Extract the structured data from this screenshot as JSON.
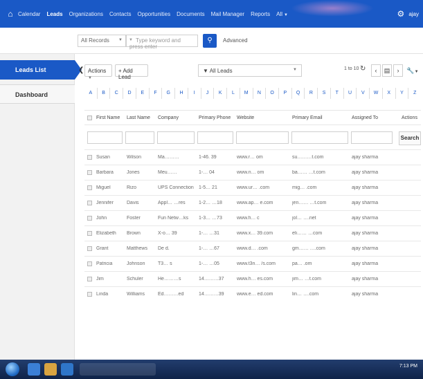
{
  "nav": {
    "items": [
      {
        "label": "Calendar",
        "active": false
      },
      {
        "label": "Leads",
        "active": true
      },
      {
        "label": "Organizations",
        "active": false
      },
      {
        "label": "Contacts",
        "active": false
      },
      {
        "label": "Opportunities",
        "active": false
      },
      {
        "label": "Documents",
        "active": false
      },
      {
        "label": "Mail Manager",
        "active": false
      },
      {
        "label": "Reports",
        "active": false
      },
      {
        "label": "All",
        "active": false
      }
    ],
    "user": "ajay",
    "home_icon": "home-icon",
    "settings_icon": "gear-icon"
  },
  "search": {
    "scope": "All Records",
    "placeholder": "Type keyword and press enter",
    "advanced": "Advanced"
  },
  "sidebar": {
    "items": [
      {
        "label": "Leads List"
      },
      {
        "label": "Dashboard"
      }
    ]
  },
  "toolbar": {
    "actions": "Actions",
    "add_lead": "+ Add Lead",
    "filter": "▼ All Leads",
    "pager_text": "1 to 10"
  },
  "alphabet": [
    "A",
    "B",
    "C",
    "D",
    "E",
    "F",
    "G",
    "H",
    "I",
    "J",
    "K",
    "L",
    "M",
    "N",
    "O",
    "P",
    "Q",
    "R",
    "S",
    "T",
    "U",
    "V",
    "W",
    "X",
    "Y",
    "Z"
  ],
  "table": {
    "headers": {
      "first_name": "First Name",
      "last_name": "Last Name",
      "company": "Company",
      "phone": "Primary Phone",
      "website": "Website",
      "email": "Primary Email",
      "assigned": "Assigned To",
      "actions": "Actions"
    },
    "search_button": "Search",
    "rows": [
      {
        "first": "Susan",
        "last": "Wilson",
        "company": "Ma………",
        "phone": "1-46.     39",
        "website": "www.r…   om",
        "email": "su………t.com",
        "assigned": "ajay sharma"
      },
      {
        "first": "Barbara",
        "last": "Jones",
        "company": "Meu……",
        "phone": "1-…    04",
        "website": "www.n…   om",
        "email": "ba…… …t.com",
        "assigned": "ajay sharma"
      },
      {
        "first": "Miguel",
        "last": "Rizo",
        "company": "UPS Connection",
        "phone": "1-5…  21",
        "website": "www.ur… .com",
        "email": "mig…   .com",
        "assigned": "ajay sharma"
      },
      {
        "first": "Jennifer",
        "last": "Davis",
        "company": "Appl… …res",
        "phone": "1-2…  …18",
        "website": "www.ap… e.com",
        "email": "jen…… …t.com",
        "assigned": "ajay sharma"
      },
      {
        "first": "John",
        "last": "Foster",
        "company": "Fun Netw…ks",
        "phone": "1-3…  …73",
        "website": "www.fi… c",
        "email": "jol… ….net",
        "assigned": "ajay sharma"
      },
      {
        "first": "Elizabeth",
        "last": "Brown",
        "company": "X-o…  39",
        "phone": "1-…  …31",
        "website": "www.x…  39.com",
        "email": "eli…… …com",
        "assigned": "ajay sharma"
      },
      {
        "first": "Grant",
        "last": "Matthews",
        "company": "De          d.",
        "phone": "1-…  …67",
        "website": "www.d…  .com",
        "email": "gm…… ….com",
        "assigned": "ajay sharma"
      },
      {
        "first": "Patricia",
        "last": "Johnson",
        "company": "T3…   s",
        "phone": "1-…  …05",
        "website": "www.t3n… /s.com",
        "email": "pa…   .om",
        "assigned": "ajay sharma"
      },
      {
        "first": "Jim",
        "last": "Schuler",
        "company": "He………s",
        "phone": "14………37",
        "website": "www.h…  es.com",
        "email": "jim… …t.com",
        "assigned": "ajay sharma"
      },
      {
        "first": "Linda",
        "last": "Williams",
        "company": "Ed………ed",
        "phone": "14………39",
        "website": "www.e…  ed.com",
        "email": "lin… ….com",
        "assigned": "ajay sharma"
      }
    ]
  },
  "taskbar": {
    "time": "7:13 PM"
  },
  "colors": {
    "brand": "#1a59c6",
    "taskbar": "#0f2348"
  }
}
